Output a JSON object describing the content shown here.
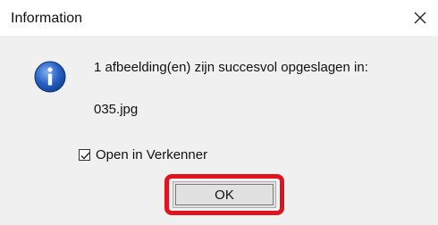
{
  "dialog": {
    "title": "Information",
    "message_line1": "1 afbeelding(en) zijn succesvol opgeslagen in:",
    "message_line2": "035.jpg",
    "icon": "info-icon",
    "checkbox": {
      "label": "Open in Verkenner",
      "checked": true
    },
    "ok_label": "OK",
    "highlight_color": "#e0141e"
  }
}
